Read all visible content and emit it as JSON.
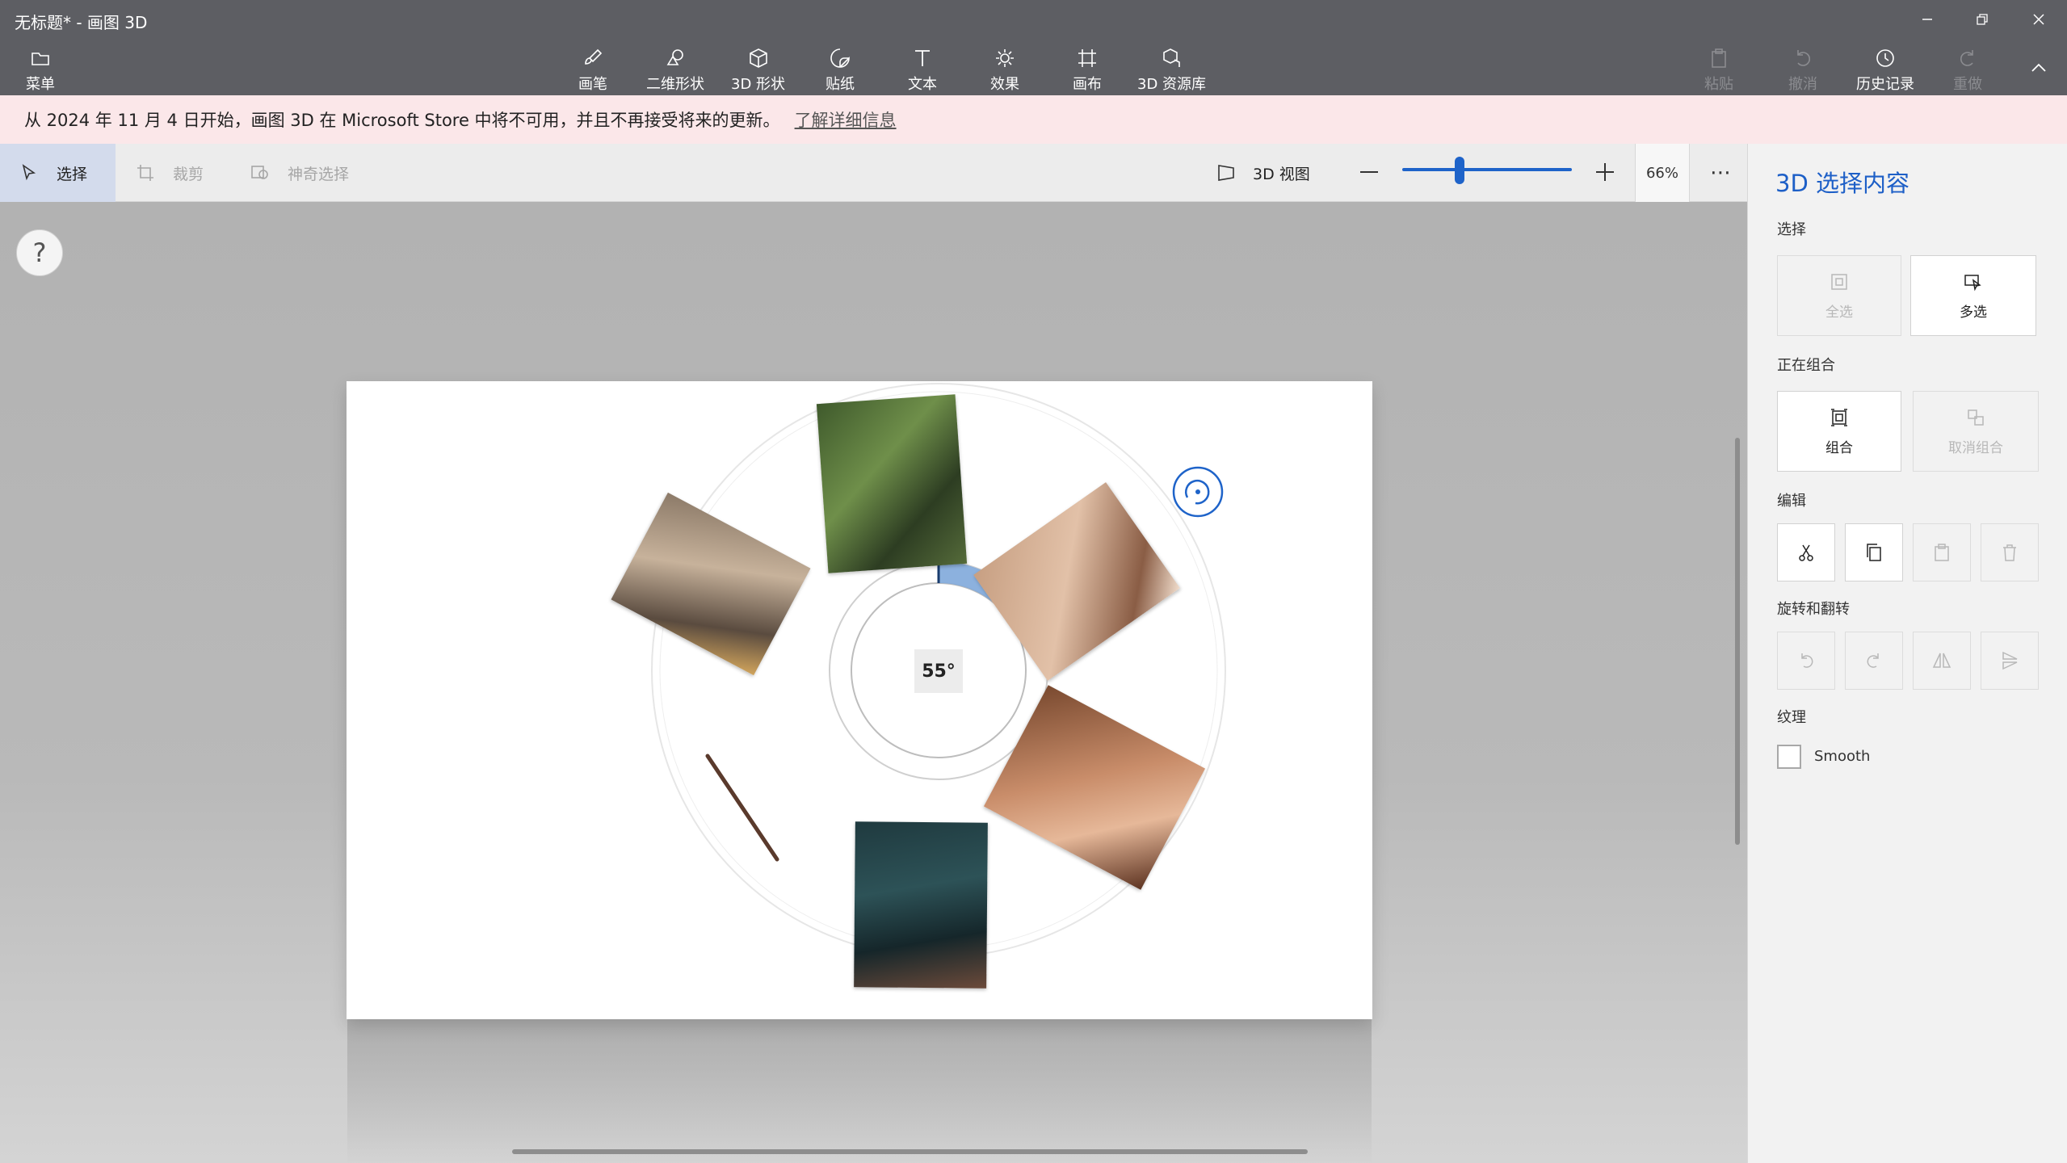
{
  "window": {
    "title": "无标题* - 画图 3D",
    "minimize_icon": "minimize-icon",
    "restore_icon": "restore-icon",
    "close_icon": "close-icon"
  },
  "ribbon": {
    "menu_label": "菜单",
    "tools": [
      {
        "label": "画笔",
        "icon": "brush-icon"
      },
      {
        "label": "二维形状",
        "icon": "2d-shapes-icon"
      },
      {
        "label": "3D 形状",
        "icon": "3d-shapes-icon"
      },
      {
        "label": "贴纸",
        "icon": "stickers-icon"
      },
      {
        "label": "文本",
        "icon": "text-icon"
      },
      {
        "label": "效果",
        "icon": "effects-icon"
      },
      {
        "label": "画布",
        "icon": "canvas-icon"
      },
      {
        "label": "3D 资源库",
        "icon": "3d-library-icon"
      }
    ],
    "right": {
      "paste": "粘贴",
      "undo": "撤消",
      "history": "历史记录",
      "redo": "重做"
    }
  },
  "notice": {
    "text": "从 2024 年 11 月 4 日开始，画图 3D 在 Microsoft Store 中将不可用，并且不再接受将来的更新。",
    "link": "了解详细信息"
  },
  "toolbar": {
    "select": "选择",
    "crop": "裁剪",
    "magic_select": "神奇选择",
    "view_3d": "3D 视图",
    "zoom_percent": "66%",
    "zoom_level": 0.34,
    "more": "⋯"
  },
  "canvas": {
    "help": "?",
    "rotation_angle": "55°",
    "rotation_fraction": 0.153
  },
  "panel": {
    "title": "3D 选择内容",
    "select_section": "选择",
    "select_all": "全选",
    "multi_select": "多选",
    "group_section": "正在组合",
    "group": "组合",
    "ungroup": "取消组合",
    "edit_section": "编辑",
    "rotate_section": "旋转和翻转",
    "texture_section": "纹理",
    "smooth": "Smooth"
  },
  "colors": {
    "title_bar": "#5d5e63",
    "notice_bg": "#fbe7e9",
    "accent": "#1e63c9",
    "panel_bg": "#f2f2f2"
  }
}
